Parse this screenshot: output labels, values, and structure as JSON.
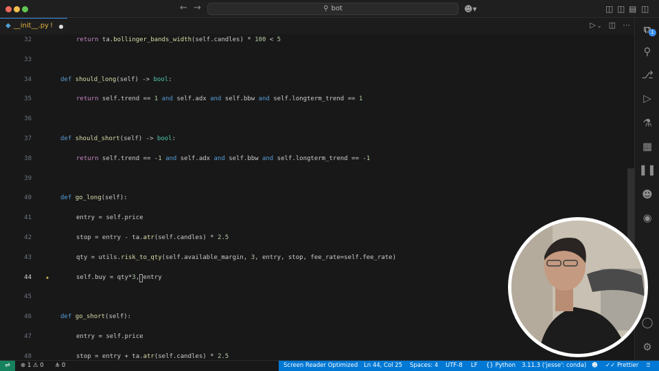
{
  "titlebar": {
    "search_text": "bot",
    "back_icon": "arrow-left-icon",
    "forward_icon": "arrow-right-icon",
    "copilot_icon": "copilot-icon"
  },
  "tab": {
    "filename": "__init__.py",
    "badge": "!",
    "language_icon": "python-icon"
  },
  "code_lines": [
    {
      "n": "32",
      "indent": true,
      "text": "return ta.bollinger_bands_width(self.candles) * 100 < 5"
    },
    {
      "n": "33",
      "indent": false,
      "text": ""
    },
    {
      "n": "34",
      "indent": false,
      "text": "def should_long(self) -> bool:"
    },
    {
      "n": "35",
      "indent": true,
      "text": "return self.trend == 1 and self.adx and self.bbw and self.longterm_trend == 1"
    },
    {
      "n": "36",
      "indent": false,
      "text": ""
    },
    {
      "n": "37",
      "indent": false,
      "text": "def should_short(self) -> bool:"
    },
    {
      "n": "38",
      "indent": true,
      "text": "return self.trend == -1 and self.adx and self.bbw and self.longterm_trend == -1"
    },
    {
      "n": "39",
      "indent": false,
      "text": ""
    },
    {
      "n": "40",
      "indent": false,
      "text": "def go_long(self):"
    },
    {
      "n": "41",
      "indent": true,
      "text": "entry = self.price"
    },
    {
      "n": "42",
      "indent": true,
      "text": "stop = entry - ta.atr(self.candles) * 2.5"
    },
    {
      "n": "43",
      "indent": true,
      "text": "qty = utils.risk_to_qty(self.available_margin, 3, entry, stop, fee_rate=self.fee_rate)"
    },
    {
      "n": "44",
      "indent": true,
      "text": "self.buy = qty*3, entry"
    },
    {
      "n": "45",
      "indent": false,
      "text": ""
    },
    {
      "n": "46",
      "indent": false,
      "text": "def go_short(self):"
    },
    {
      "n": "47",
      "indent": true,
      "text": "entry = self.price"
    },
    {
      "n": "48",
      "indent": true,
      "text": "stop = entry + ta.atr(self.candles) * 2.5"
    }
  ],
  "active_line": "44",
  "statusbar": {
    "errors": "1",
    "warnings": "0",
    "ports": "0",
    "screen_reader": "Screen Reader Optimized",
    "position": "Ln 44, Col 25",
    "spaces": "Spaces: 4",
    "encoding": "UTF-8",
    "eol": "LF",
    "language": "Python",
    "interpreter": "3.11.3 ('jesse': conda)",
    "prettier": "Prettier"
  },
  "activity_bar": {
    "items": [
      "explorer-icon",
      "search-icon",
      "source-control-icon",
      "run-debug-icon",
      "testing-icon",
      "extensions-icon",
      "pause-icon",
      "copilot-icon",
      "github-icon",
      "account-icon",
      "settings-gear-icon"
    ],
    "explorer_badge": "1"
  },
  "colors": {
    "accent": "#0078d4",
    "remote": "#16825d",
    "editor_bg": "#181818"
  }
}
